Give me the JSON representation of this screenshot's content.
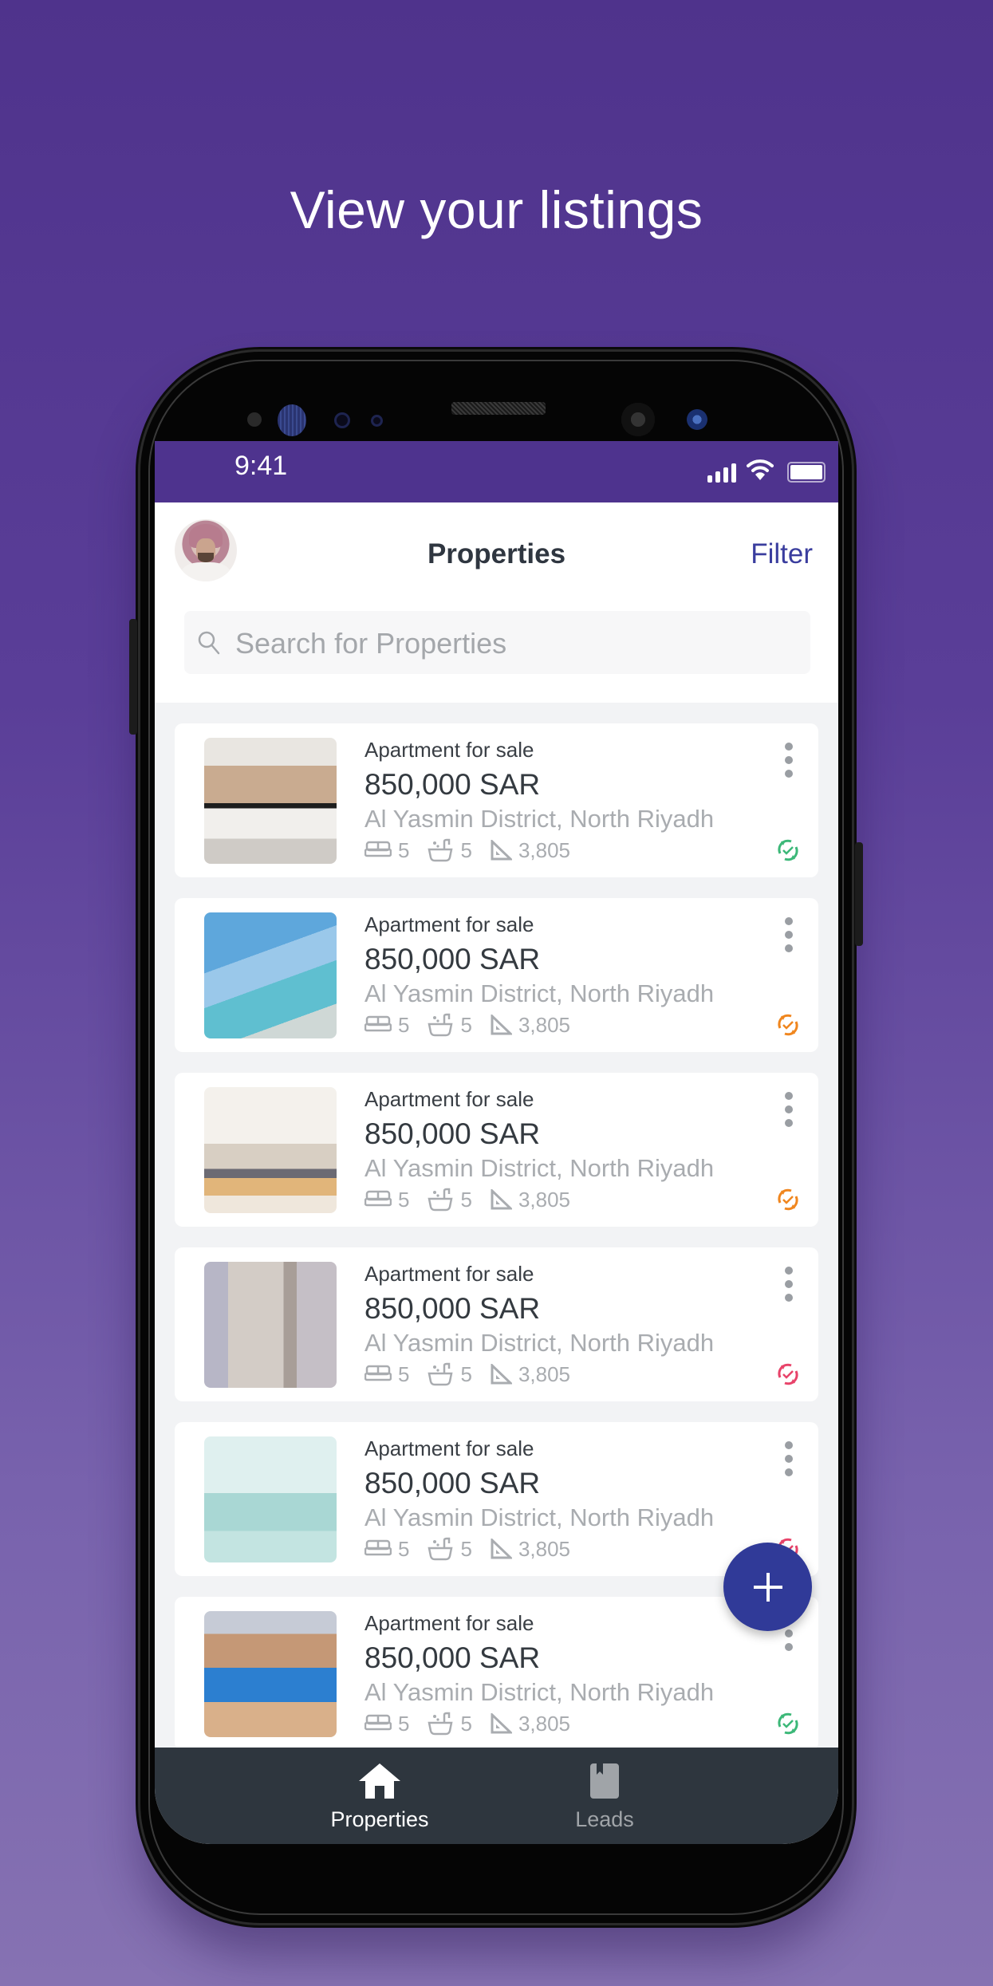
{
  "headline": "View your listings",
  "status_bar": {
    "time": "9:41",
    "icons": [
      "signal-icon",
      "wifi-icon",
      "battery-icon"
    ]
  },
  "header": {
    "title": "Properties",
    "filter_label": "Filter",
    "avatar": "user-avatar"
  },
  "search": {
    "placeholder": "Search for Properties"
  },
  "colors": {
    "background_top": "#4f338c",
    "background_bottom": "#8672b2",
    "status_bar": "#4e338e",
    "accent": "#3a3d9e",
    "fab": "#303a98",
    "bottom_nav": "#2e363e",
    "status_active": "#3cb878",
    "status_pending": "#f0861e",
    "status_inactive": "#e8436a"
  },
  "listings": [
    {
      "type": "Apartment for sale",
      "price": "850,000 SAR",
      "location": "Al Yasmin District, North Riyadh",
      "beds": "5",
      "baths": "5",
      "area": "3,805",
      "status": "green",
      "image": "kitchen-interior"
    },
    {
      "type": "Apartment for sale",
      "price": "850,000 SAR",
      "location": "Al Yasmin District, North Riyadh",
      "beds": "5",
      "baths": "5",
      "area": "3,805",
      "status": "orange",
      "image": "rooftop-pool-city"
    },
    {
      "type": "Apartment for sale",
      "price": "850,000 SAR",
      "location": "Al Yasmin District, North Riyadh",
      "beds": "5",
      "baths": "5",
      "area": "3,805",
      "status": "orange",
      "image": "living-room"
    },
    {
      "type": "Apartment for sale",
      "price": "850,000 SAR",
      "location": "Al Yasmin District, North Riyadh",
      "beds": "5",
      "baths": "5",
      "area": "3,805",
      "status": "red",
      "image": "apartment-tower"
    },
    {
      "type": "Apartment for sale",
      "price": "850,000 SAR",
      "location": "Al Yasmin District, North Riyadh",
      "beds": "5",
      "baths": "5",
      "area": "3,805",
      "status": "red",
      "image": "indoor-pool"
    },
    {
      "type": "Apartment for sale",
      "price": "850,000 SAR",
      "location": "Al Yasmin District, North Riyadh",
      "beds": "5",
      "baths": "5",
      "area": "3,805",
      "status": "green",
      "image": "courtyard-pool"
    }
  ],
  "fab": {
    "icon": "plus-icon"
  },
  "bottom_nav": {
    "items": [
      {
        "label": "Properties",
        "icon": "home-icon",
        "active": true
      },
      {
        "label": "Leads",
        "icon": "book-icon",
        "active": false
      }
    ]
  }
}
